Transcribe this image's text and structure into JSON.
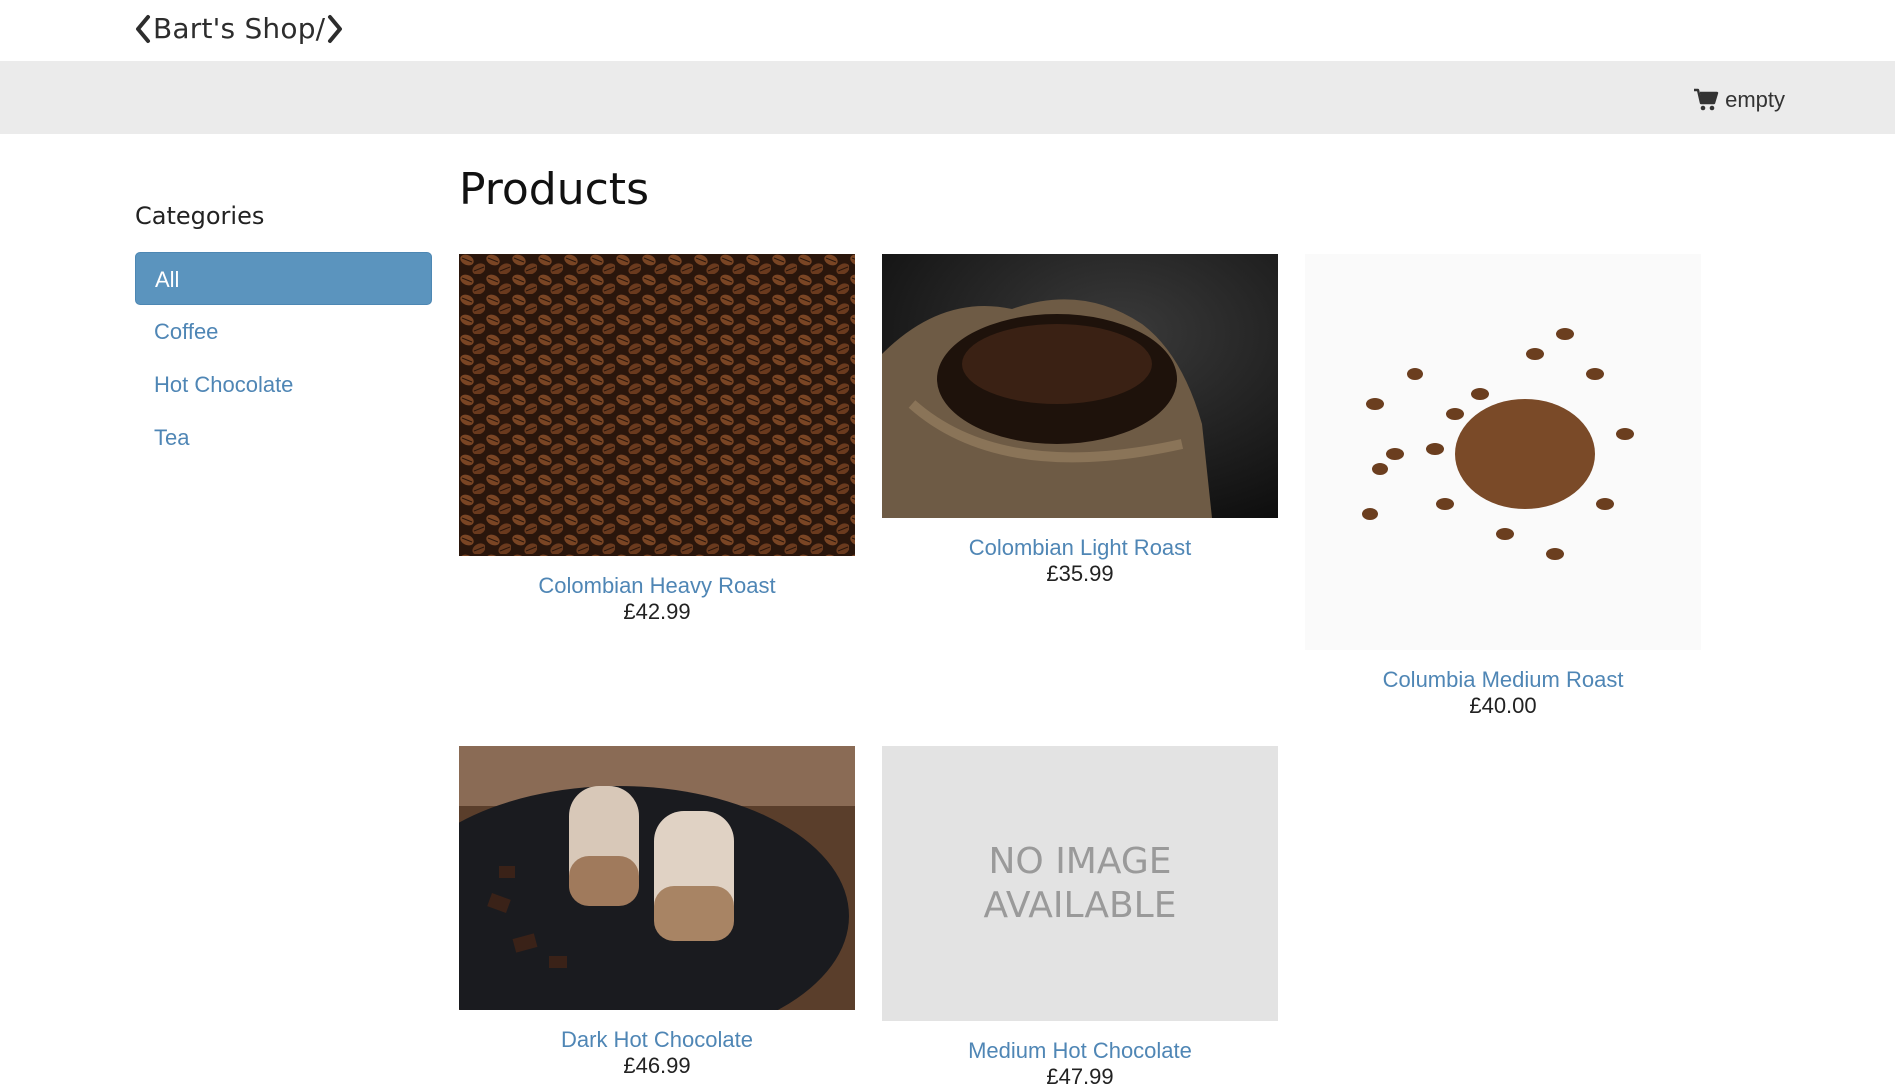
{
  "header": {
    "brand": "Bart's Shop/",
    "cart_label": "empty"
  },
  "sidebar": {
    "title": "Categories",
    "items": [
      {
        "label": "All",
        "active": true
      },
      {
        "label": "Coffee",
        "active": false
      },
      {
        "label": "Hot Chocolate",
        "active": false
      },
      {
        "label": "Tea",
        "active": false
      }
    ]
  },
  "main": {
    "title": "Products",
    "products": [
      {
        "name": "Colombian Heavy Roast",
        "price": "£42.99",
        "image": "coffee-beans-closeup"
      },
      {
        "name": "Colombian Light Roast",
        "price": "£35.99",
        "image": "coffee-sack"
      },
      {
        "name": "Columbia Medium Roast",
        "price": "£40.00",
        "image": "scattered-beans-white"
      },
      {
        "name": "Dark Hot Chocolate",
        "price": "£46.99",
        "image": "hot-chocolate-glasses"
      },
      {
        "name": "Medium Hot Chocolate",
        "price": "£47.99",
        "image": "no-image-placeholder"
      }
    ],
    "placeholder_text": [
      "NO IMAGE",
      "AVAILABLE"
    ]
  },
  "colors": {
    "link": "#4f86b5",
    "active_category": "#5b94be",
    "cartbar_bg": "#ebebeb"
  }
}
